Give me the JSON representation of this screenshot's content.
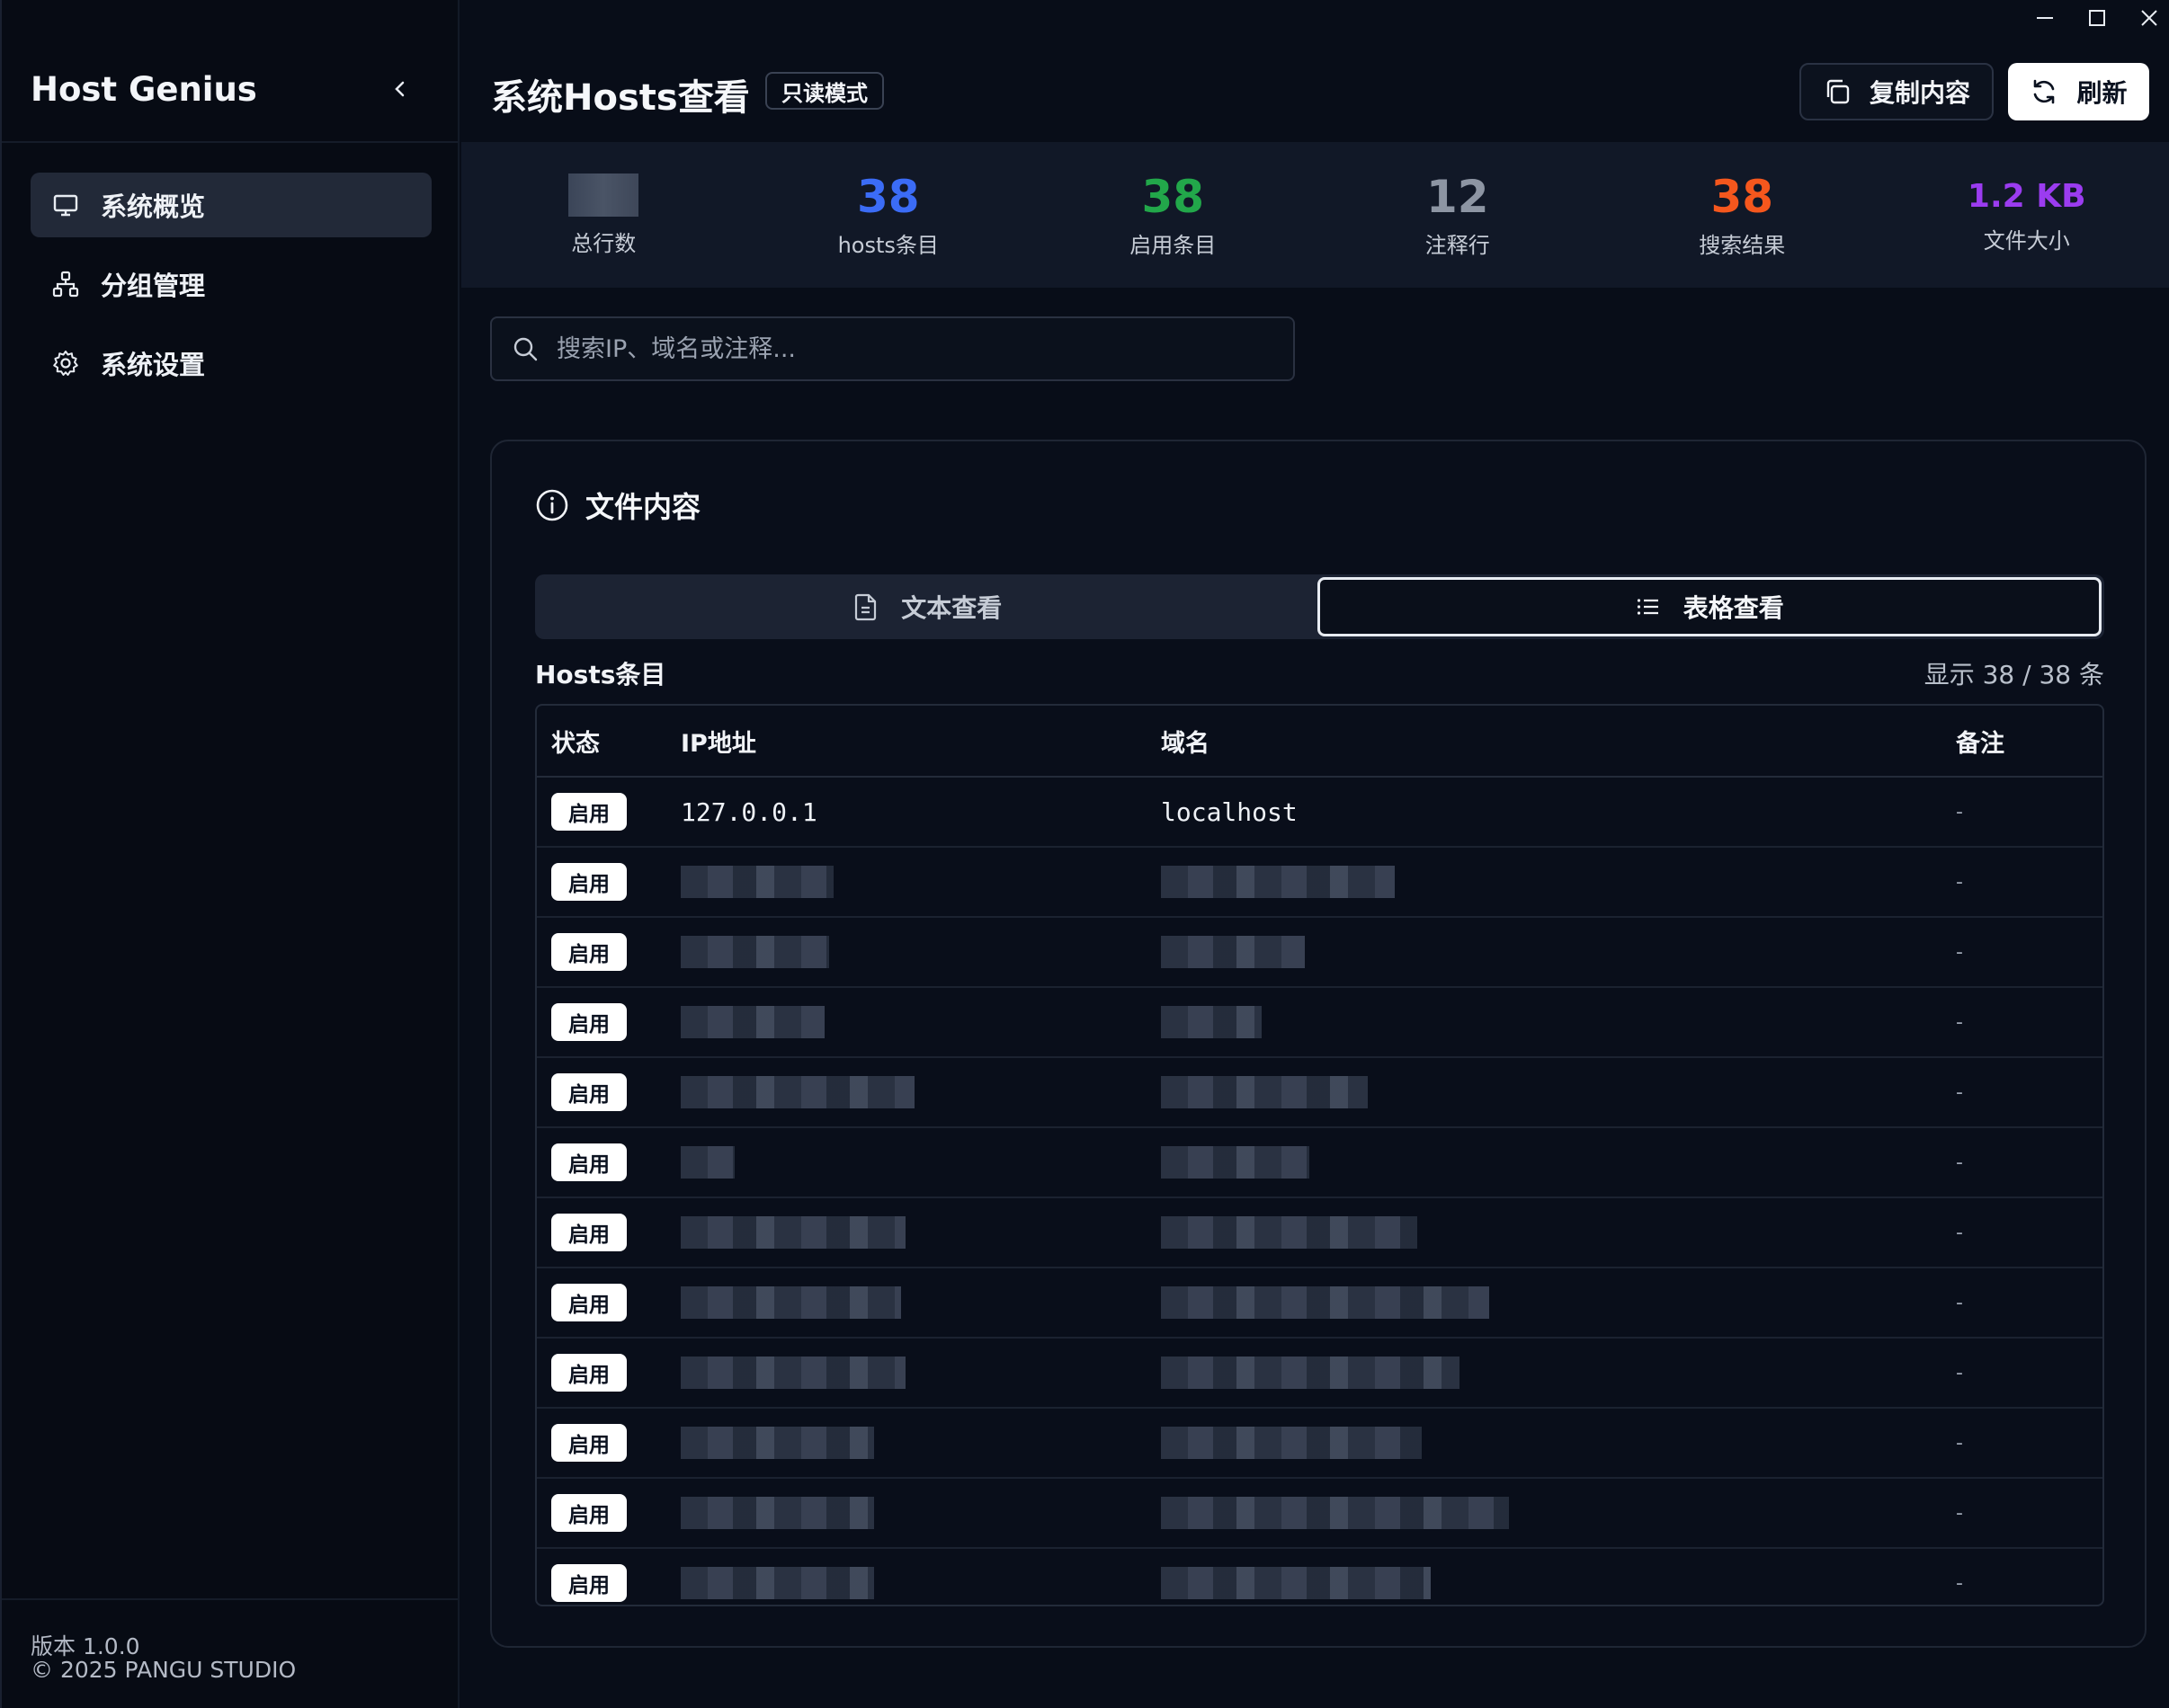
{
  "app": {
    "brand": "Host Genius"
  },
  "sidebar": {
    "items": [
      {
        "label": "系统概览",
        "icon": "monitor-icon",
        "active": true
      },
      {
        "label": "分组管理",
        "icon": "sitemap-icon",
        "active": false
      },
      {
        "label": "系统设置",
        "icon": "gear-icon",
        "active": false
      }
    ],
    "version": "版本 1.0.0",
    "copyright": "© 2025 PANGU STUDIO"
  },
  "header": {
    "title": "系统Hosts查看",
    "mode_badge": "只读模式",
    "copy_label": "复制内容",
    "refresh_label": "刷新"
  },
  "stats": [
    {
      "label": "总行数",
      "value": "",
      "color": "#9aa2b0"
    },
    {
      "label": "hosts条目",
      "value": "38",
      "color": "#3b6cf6"
    },
    {
      "label": "启用条目",
      "value": "38",
      "color": "#22a74a"
    },
    {
      "label": "注释行",
      "value": "12",
      "color": "#8d95a3"
    },
    {
      "label": "搜索结果",
      "value": "38",
      "color": "#f5571d"
    },
    {
      "label": "文件大小",
      "value": "1.2 KB",
      "color": "#9b3cf0"
    }
  ],
  "search": {
    "placeholder": "搜索IP、域名或注释..."
  },
  "card": {
    "title": "文件内容",
    "tabs": [
      {
        "label": "文本查看",
        "icon": "document-icon",
        "active": false
      },
      {
        "label": "表格查看",
        "icon": "list-icon",
        "active": true
      }
    ],
    "list_title": "Hosts条目",
    "list_count": "显示 38 / 38 条",
    "columns": [
      "状态",
      "IP地址",
      "域名",
      "备注"
    ],
    "rows": [
      {
        "status": "启用",
        "ip": "127.0.0.1",
        "domain": "localhost",
        "note": "-"
      },
      {
        "status": "启用",
        "ip": "",
        "domain": "",
        "note": "-"
      },
      {
        "status": "启用",
        "ip": "",
        "domain": "",
        "note": "-"
      },
      {
        "status": "启用",
        "ip": "",
        "domain": "",
        "note": "-"
      },
      {
        "status": "启用",
        "ip": "",
        "domain": "",
        "note": "-"
      },
      {
        "status": "启用",
        "ip": "",
        "domain": "",
        "note": "-"
      },
      {
        "status": "启用",
        "ip": "",
        "domain": "",
        "note": "-"
      },
      {
        "status": "启用",
        "ip": "",
        "domain": "",
        "note": "-"
      },
      {
        "status": "启用",
        "ip": "",
        "domain": "",
        "note": "-"
      },
      {
        "status": "启用",
        "ip": "",
        "domain": "",
        "note": "-"
      },
      {
        "status": "启用",
        "ip": "",
        "domain": "",
        "note": "-"
      },
      {
        "status": "启用",
        "ip": "",
        "domain": "",
        "note": "-"
      }
    ]
  }
}
